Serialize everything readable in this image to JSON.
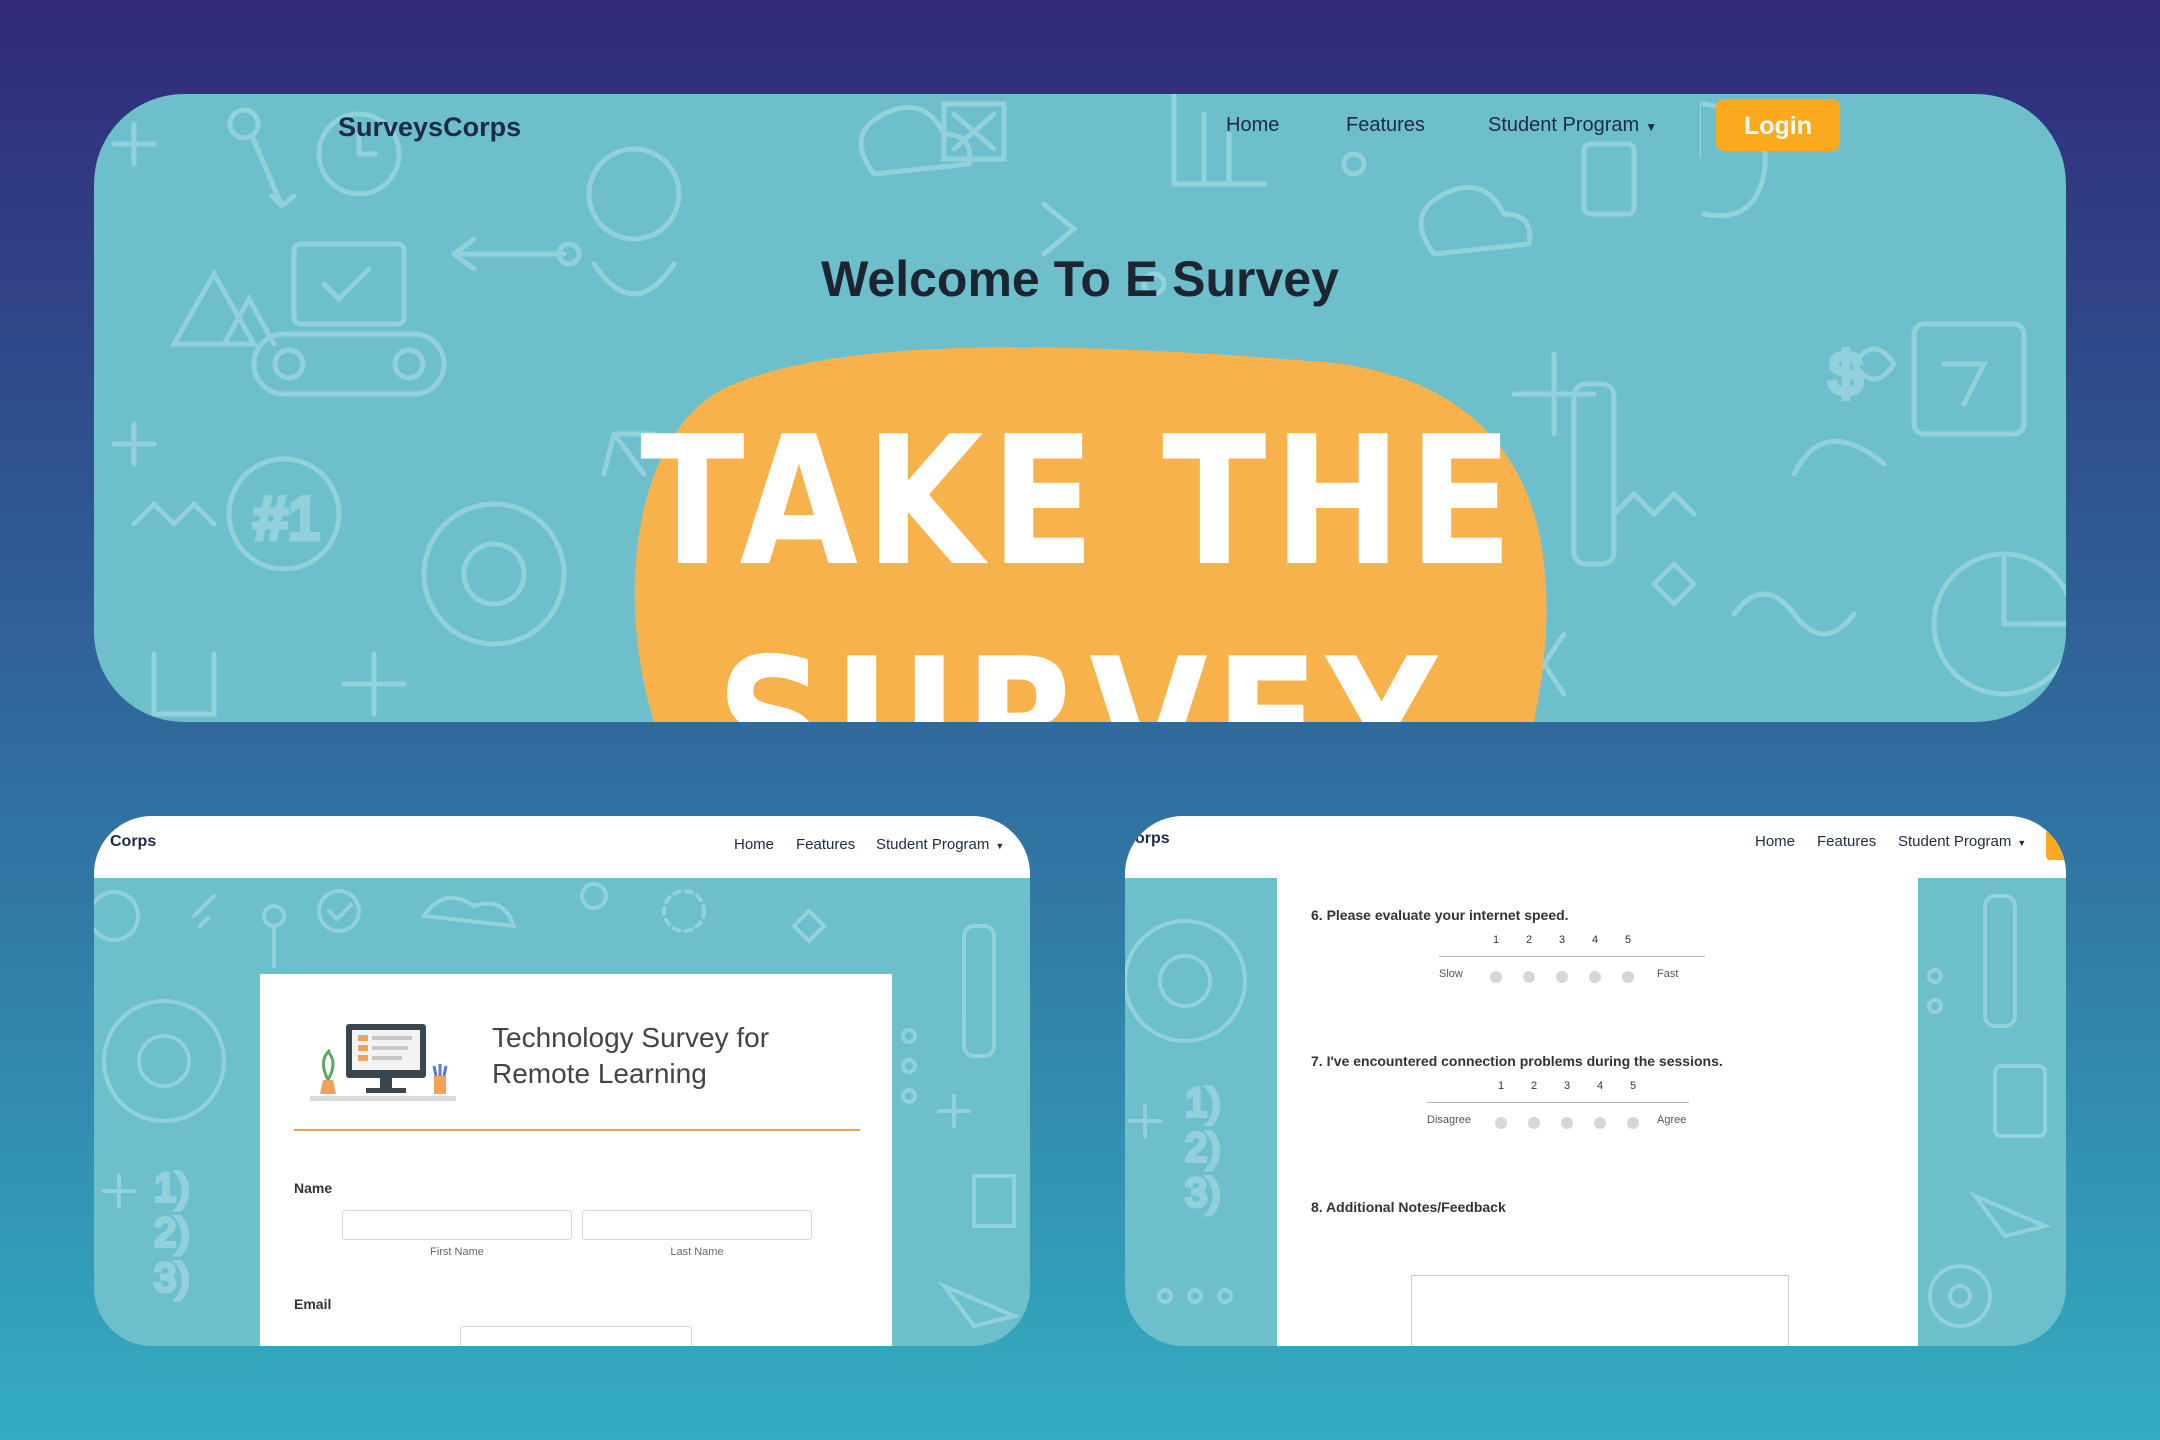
{
  "hero": {
    "brand": "SurveysCorps",
    "nav": {
      "home": "Home",
      "features": "Features",
      "student_program": "Student Program"
    },
    "login_label": "Login",
    "title": "Welcome To E Survey",
    "graphic_line1": "TAKE THE",
    "graphic_line2": "SURVEY"
  },
  "form_shot": {
    "brand": "Corps",
    "nav": {
      "home": "Home",
      "features": "Features",
      "student_program": "Student Program"
    },
    "title_line1": "Technology Survey for",
    "title_line2": "Remote Learning",
    "name_label": "Name",
    "first_name_label": "First Name",
    "last_name_label": "Last Name",
    "email_label": "Email"
  },
  "questions_shot": {
    "brand": "orps",
    "nav": {
      "home": "Home",
      "features": "Features",
      "student_program": "Student Program"
    },
    "q6": {
      "text": "6. Please evaluate your internet speed.",
      "scale": [
        "1",
        "2",
        "3",
        "4",
        "5"
      ],
      "low": "Slow",
      "high": "Fast"
    },
    "q7": {
      "text": "7. I've encountered connection problems during the sessions.",
      "scale": [
        "1",
        "2",
        "3",
        "4",
        "5"
      ],
      "low": "Disagree",
      "high": "Agree"
    },
    "q8": {
      "text": "8. Additional Notes/Feedback"
    }
  },
  "colors": {
    "pattern_bg": "#6dbfcc",
    "accent_orange": "#fbaa1f",
    "blob_orange": "#f8b24b",
    "rule_orange": "#e8a64c"
  }
}
